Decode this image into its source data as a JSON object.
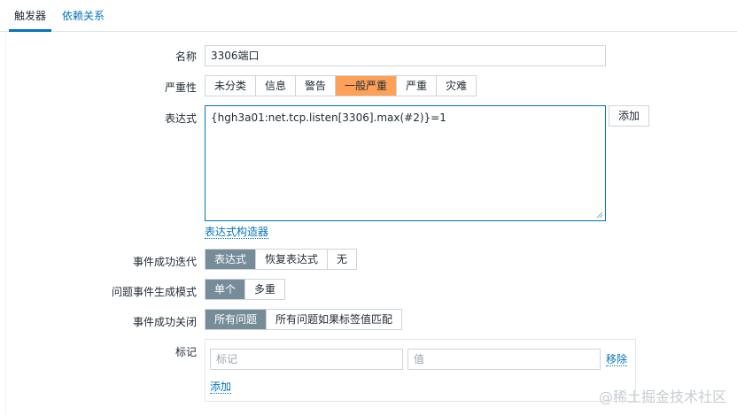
{
  "tabs": [
    {
      "label": "触发器",
      "active": true
    },
    {
      "label": "依赖关系",
      "active": false
    }
  ],
  "form": {
    "name": {
      "label": "名称",
      "value": "3306端口"
    },
    "severity": {
      "label": "严重性",
      "options": [
        "未分类",
        "信息",
        "警告",
        "一般严重",
        "严重",
        "灾难"
      ],
      "selected": "一般严重"
    },
    "expression": {
      "label": "表达式",
      "value": "{hgh3a01:net.tcp.listen[3306].max(#2)}=1",
      "add_button": "添加",
      "constructor_link": "表达式构造器"
    },
    "ok_event_generation": {
      "label": "事件成功迭代",
      "options": [
        "表达式",
        "恢复表达式",
        "无"
      ],
      "selected": "表达式"
    },
    "problem_event_mode": {
      "label": "问题事件生成模式",
      "options": [
        "单个",
        "多重"
      ],
      "selected": "单个"
    },
    "ok_event_closes": {
      "label": "事件成功关闭",
      "options": [
        "所有问题",
        "所有问题如果标签值匹配"
      ],
      "selected": "所有问题"
    },
    "tags": {
      "label": "标记",
      "tag_placeholder": "标记",
      "value_placeholder": "值",
      "remove_link": "移除",
      "add_link": "添加"
    }
  },
  "watermark": "@稀土掘金技术社区",
  "colors": {
    "accent": "#0275b8",
    "selected_gray": "#768d99",
    "selected_orange": "#ffa059"
  }
}
